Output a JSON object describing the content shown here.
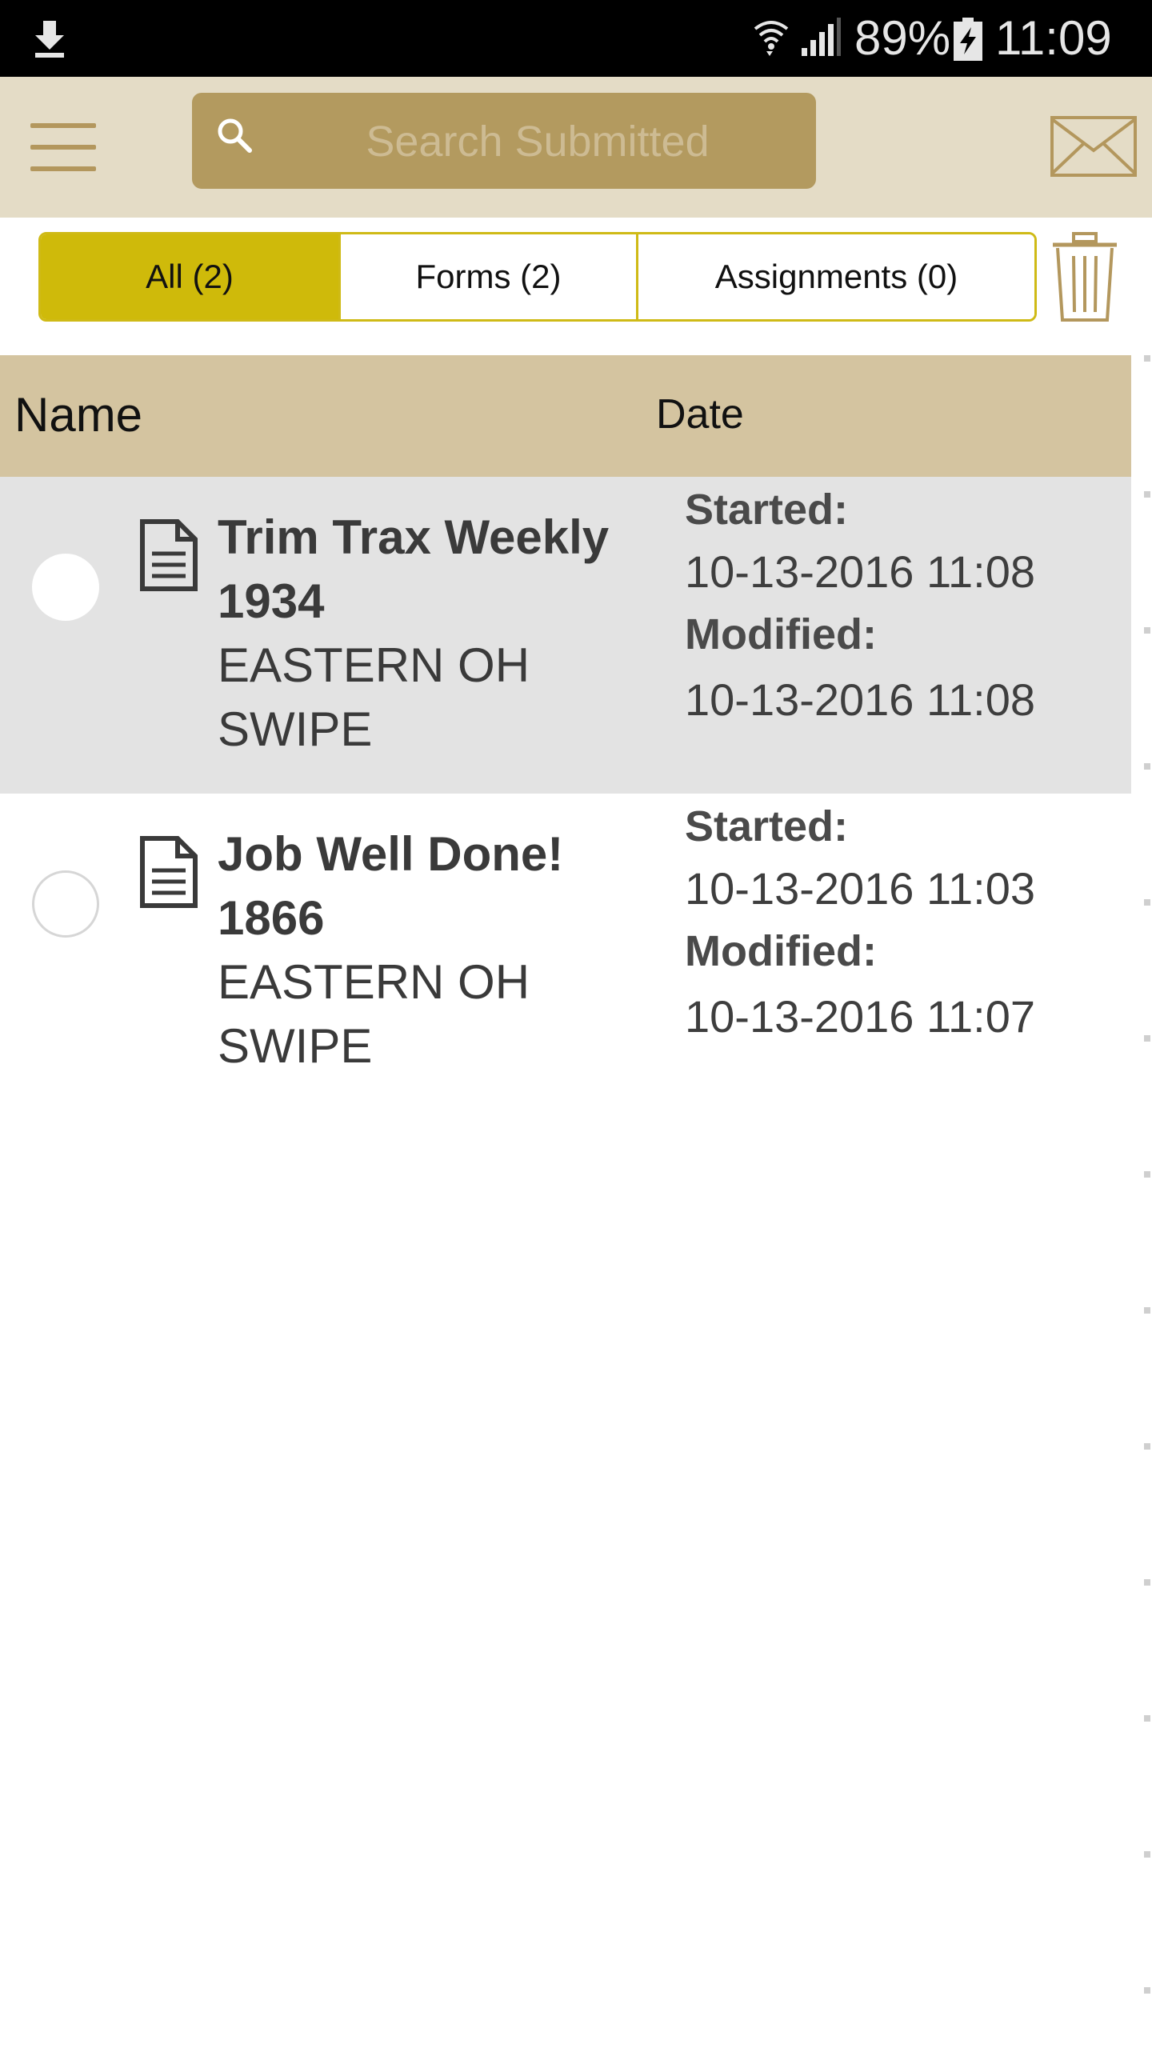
{
  "status_bar": {
    "battery_percent": "89%",
    "time": "11:09",
    "icons": [
      "download-icon",
      "wifi-icon",
      "signal-icon",
      "battery-charging-icon"
    ]
  },
  "header": {
    "menu_icon": "hamburger-icon",
    "search": {
      "placeholder": "Search Submitted",
      "value": ""
    },
    "mail_icon": "envelope-icon"
  },
  "tabs": {
    "items": [
      {
        "label": "All (2)",
        "active": true
      },
      {
        "label": "Forms (2)",
        "active": false
      },
      {
        "label": "Assignments (0)",
        "active": false
      }
    ],
    "delete_icon": "trash-icon"
  },
  "table": {
    "columns": {
      "name": "Name",
      "date": "Date"
    },
    "rows": [
      {
        "title": "Trim Trax Weekly 1934",
        "subtitle": "EASTERN OH SWIPE",
        "started_label": "Started:",
        "started": "10-13-2016 11:08",
        "modified_label": "Modified:",
        "modified": "10-13-2016 11:08",
        "highlighted": true
      },
      {
        "title": "Job Well Done! 1866",
        "subtitle": "EASTERN OH SWIPE",
        "started_label": "Started:",
        "started": "10-13-2016 11:03",
        "modified_label": "Modified:",
        "modified": "10-13-2016 11:07",
        "highlighted": false
      }
    ]
  },
  "colors": {
    "header_bg": "#e4dcc6",
    "search_bg": "#b39a5f",
    "accent_gold": "#b3975d",
    "tab_active": "#cfba0a",
    "table_header_bg": "#d4c4a0",
    "row_highlight": "#e3e3e3"
  }
}
